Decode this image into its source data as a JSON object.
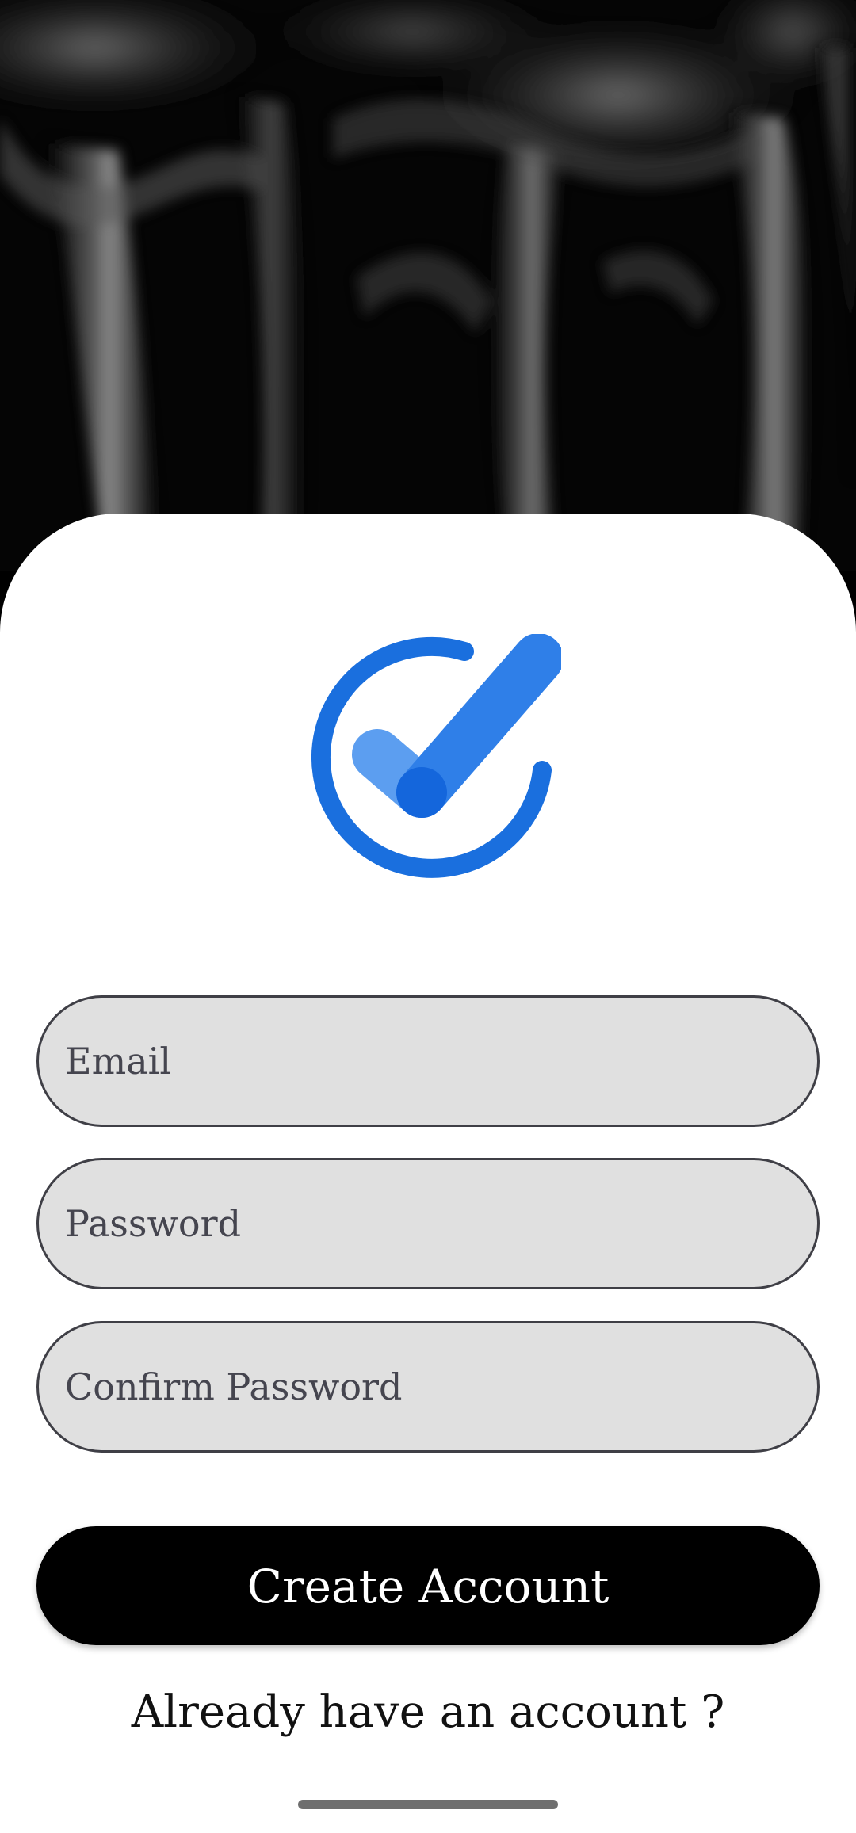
{
  "hero": {
    "image": "black-silk-fabric-background"
  },
  "logo": {
    "icon": "checkmark-circle-logo",
    "colors": {
      "ring": "#1a6fde",
      "check_long": "#2f7fe8",
      "check_short": "#5c9ef0",
      "check_joint": "#1466dc"
    }
  },
  "form": {
    "email_placeholder": "Email",
    "password_placeholder": "Password",
    "confirm_placeholder": "Confirm Password"
  },
  "actions": {
    "create_label": "Create Account",
    "signin_label": "Already have an account ?"
  },
  "colors": {
    "field_bg": "#e0e0e0",
    "field_border": "#3f3f46",
    "button_bg": "#000000",
    "button_text": "#ffffff"
  }
}
